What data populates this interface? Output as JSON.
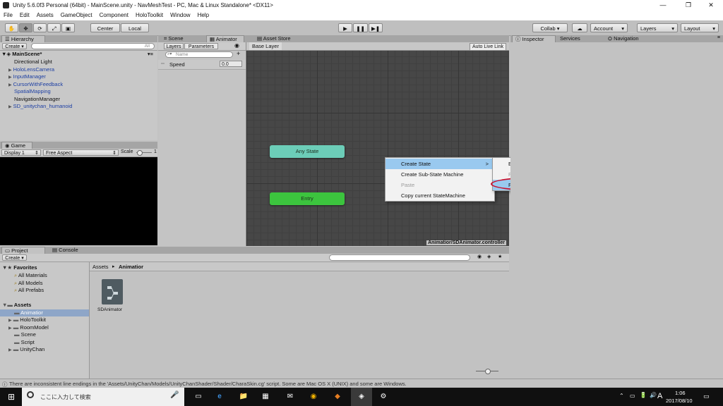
{
  "window": {
    "title": "Unity 5.6.0f3 Personal (64bit) - MainScene.unity - NavMeshTest - PC, Mac & Linux Standalone* <DX11>",
    "minimize": "—",
    "maximize": "❐",
    "close": "✕"
  },
  "menu": [
    "File",
    "Edit",
    "Assets",
    "GameObject",
    "Component",
    "HoloToolkit",
    "Window",
    "Help"
  ],
  "toolbar": {
    "tools": [
      "✋",
      "✥",
      "⟳",
      "⤢",
      "▣"
    ],
    "pivot": "Center",
    "space": "Local",
    "play": "▶",
    "pause": "❚❚",
    "step": "▶❚",
    "collab": "Collab ▾",
    "cloud": "☁",
    "account": "Account",
    "layers": "Layers",
    "layout": "Layout"
  },
  "hierarchy": {
    "tab": "Hierarchy",
    "create": "Create ▾",
    "search_placeholder": "All",
    "scene": "MainScene*",
    "items": [
      {
        "label": "Directional Light",
        "arrow": "",
        "blue": false
      },
      {
        "label": "HoloLensCamera",
        "arrow": "▶",
        "blue": true
      },
      {
        "label": "InputManager",
        "arrow": "▶",
        "blue": true
      },
      {
        "label": "CursorWithFeedback",
        "arrow": "▶",
        "blue": true
      },
      {
        "label": "SpatialMapping",
        "arrow": "",
        "blue": true
      },
      {
        "label": "NavigationManager",
        "arrow": "",
        "blue": false
      },
      {
        "label": "SD_unitychan_humanoid",
        "arrow": "▶",
        "blue": true
      }
    ]
  },
  "game": {
    "tab": "Game",
    "display": "Display 1",
    "aspect": "Free Aspect",
    "scale_label": "Scale",
    "scale_value": "1"
  },
  "animator": {
    "tabs": [
      "Scene",
      "Animator",
      "Asset Store"
    ],
    "layers_tab": "Layers",
    "parameters_tab": "Parameters",
    "param_search_placeholder": "Name",
    "parameters": [
      {
        "name": "Speed",
        "value": "0.0"
      }
    ],
    "base_layer": "Base Layer",
    "auto_live_link": "Auto Live Link",
    "any_state": "Any State",
    "entry": "Entry",
    "path": "Animatior/SDAnimator.controller"
  },
  "context_menu": {
    "items": [
      {
        "label": "Create State",
        "highlight": true,
        "disabled": false,
        "submenu": true
      },
      {
        "label": "Create Sub-State Machine",
        "highlight": false,
        "disabled": false,
        "submenu": false
      },
      {
        "label": "Paste",
        "highlight": false,
        "disabled": true,
        "submenu": false
      },
      {
        "label": "Copy current StateMachine",
        "highlight": false,
        "disabled": false,
        "submenu": false
      }
    ],
    "submenu": [
      {
        "label": "Empty",
        "highlight": false,
        "disabled": false
      },
      {
        "label": "From Selected Clip",
        "highlight": false,
        "disabled": true
      },
      {
        "label": "From New Blend Tree",
        "highlight": true,
        "disabled": false
      }
    ],
    "arrow": ">",
    "annotation_color": "#c8102e"
  },
  "inspector": {
    "tabs": [
      "Inspector",
      "Services",
      "Navigation"
    ]
  },
  "project": {
    "tabs": [
      "Project",
      "Console"
    ],
    "create": "Create ▾",
    "favorites_label": "Favorites",
    "favorites": [
      "All Materials",
      "All Models",
      "All Prefabs"
    ],
    "assets_label": "Assets",
    "assets": [
      {
        "label": "Animatior",
        "arrow": "",
        "selected": true
      },
      {
        "label": "HoloToolkit",
        "arrow": "▶",
        "selected": false
      },
      {
        "label": "RoomModel",
        "arrow": "▶",
        "selected": false
      },
      {
        "label": "Scene",
        "arrow": "",
        "selected": false
      },
      {
        "label": "Script",
        "arrow": "",
        "selected": false
      },
      {
        "label": "UnityChan",
        "arrow": "▶",
        "selected": false
      }
    ],
    "breadcrumb": [
      "Assets",
      "Animatior"
    ],
    "breadcrumb_sep": "▸",
    "file_name": "SDAnimator"
  },
  "status": {
    "message": "There are inconsistent line endings in the 'Assets/UnityChan/Models/UnityChanShader/Shader/CharaSkin.cg' script. Some are Mac OS X (UNIX) and some are Windows."
  },
  "taskbar": {
    "search_placeholder": "ここに入力して検索",
    "time": "1:06",
    "date": "2017/08/10",
    "ime": "A",
    "icons": [
      "🎤",
      "▭",
      "e",
      "📁",
      "▦",
      "✉",
      "◉",
      "◆",
      "◈",
      "⚙"
    ],
    "tray": [
      "⌃",
      "▭",
      "🔋",
      "🔊"
    ]
  }
}
